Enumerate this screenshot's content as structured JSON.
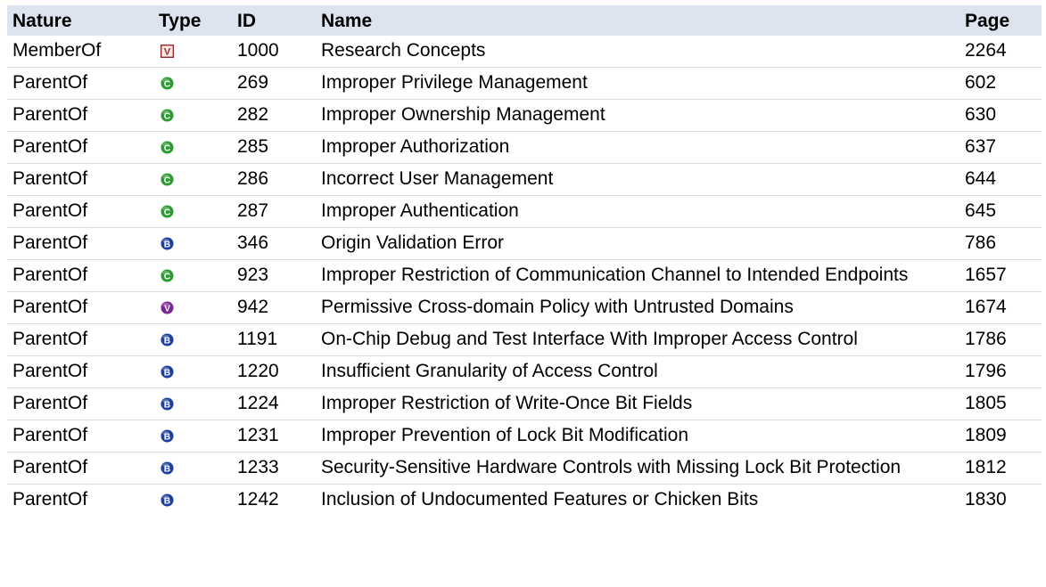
{
  "headers": {
    "nature": "Nature",
    "type": "Type",
    "id": "ID",
    "name": "Name",
    "page": "Page"
  },
  "icon_colors": {
    "category_v": "#9a2b2b",
    "class": "#2c9a33",
    "base": "#1f3f9f",
    "variant": "#7b2795"
  },
  "rows": [
    {
      "nature": "MemberOf",
      "type_icon": "view-icon",
      "type_letter": "V",
      "id": "1000",
      "name": "Research Concepts",
      "page": "2264"
    },
    {
      "nature": "ParentOf",
      "type_icon": "class-icon",
      "type_letter": "C",
      "id": "269",
      "name": "Improper Privilege Management",
      "page": "602"
    },
    {
      "nature": "ParentOf",
      "type_icon": "class-icon",
      "type_letter": "C",
      "id": "282",
      "name": "Improper Ownership Management",
      "page": "630"
    },
    {
      "nature": "ParentOf",
      "type_icon": "class-icon",
      "type_letter": "C",
      "id": "285",
      "name": "Improper Authorization",
      "page": "637"
    },
    {
      "nature": "ParentOf",
      "type_icon": "class-icon",
      "type_letter": "C",
      "id": "286",
      "name": "Incorrect User Management",
      "page": "644"
    },
    {
      "nature": "ParentOf",
      "type_icon": "class-icon",
      "type_letter": "C",
      "id": "287",
      "name": "Improper Authentication",
      "page": "645"
    },
    {
      "nature": "ParentOf",
      "type_icon": "base-icon",
      "type_letter": "B",
      "id": "346",
      "name": "Origin Validation Error",
      "page": "786"
    },
    {
      "nature": "ParentOf",
      "type_icon": "class-icon",
      "type_letter": "C",
      "id": "923",
      "name": "Improper Restriction of Communication Channel to Intended Endpoints",
      "page": "1657"
    },
    {
      "nature": "ParentOf",
      "type_icon": "variant-icon",
      "type_letter": "V",
      "id": "942",
      "name": "Permissive Cross-domain Policy with Untrusted Domains",
      "page": "1674"
    },
    {
      "nature": "ParentOf",
      "type_icon": "base-icon",
      "type_letter": "B",
      "id": "1191",
      "name": "On-Chip Debug and Test Interface With Improper Access Control",
      "page": "1786"
    },
    {
      "nature": "ParentOf",
      "type_icon": "base-icon",
      "type_letter": "B",
      "id": "1220",
      "name": "Insufficient Granularity of Access Control",
      "page": "1796"
    },
    {
      "nature": "ParentOf",
      "type_icon": "base-icon",
      "type_letter": "B",
      "id": "1224",
      "name": "Improper Restriction of Write-Once Bit Fields",
      "page": "1805"
    },
    {
      "nature": "ParentOf",
      "type_icon": "base-icon",
      "type_letter": "B",
      "id": "1231",
      "name": "Improper Prevention of Lock Bit Modification",
      "page": "1809"
    },
    {
      "nature": "ParentOf",
      "type_icon": "base-icon",
      "type_letter": "B",
      "id": "1233",
      "name": "Security-Sensitive Hardware Controls with Missing Lock Bit Protection",
      "page": "1812"
    },
    {
      "nature": "ParentOf",
      "type_icon": "base-icon",
      "type_letter": "B",
      "id": "1242",
      "name": "Inclusion of Undocumented Features or Chicken Bits",
      "page": "1830"
    }
  ]
}
